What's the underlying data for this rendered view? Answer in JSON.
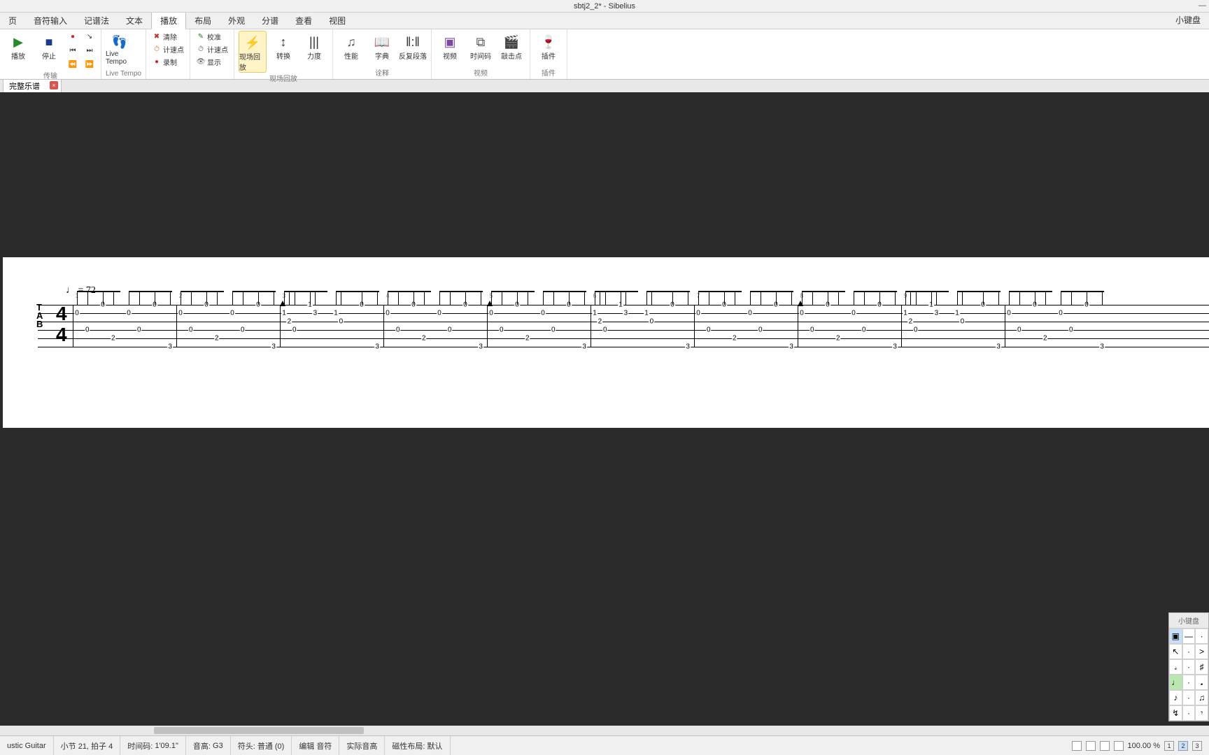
{
  "window": {
    "title": "sbtj2_2* - Sibelius",
    "minimize": "—"
  },
  "menu": {
    "tabs": [
      "页",
      "音符输入",
      "记谱法",
      "文本",
      "播放",
      "布局",
      "外观",
      "分谱",
      "查看",
      "视图"
    ],
    "active_index": 4,
    "right_label": "小键盘"
  },
  "ribbon": {
    "groups": [
      {
        "label": "传输",
        "items": [
          {
            "kind": "big",
            "name": "播放",
            "icon": "▶",
            "color": "#2a8a2a"
          },
          {
            "kind": "big",
            "name": "停止",
            "icon": "■",
            "color": "#1a3a8a"
          },
          {
            "kind": "transport",
            "cells": [
              "●",
              "↘",
              "⏮",
              "⏭",
              "⏪",
              "⏩"
            ]
          }
        ]
      },
      {
        "label": "Live Tempo",
        "items": [
          {
            "kind": "big",
            "name": "Live Tempo",
            "icon": "👣",
            "selected": false
          }
        ]
      },
      {
        "label": "",
        "items": [
          {
            "kind": "stack",
            "rows": [
              {
                "icon": "✖",
                "color": "#c03030",
                "label": "清除"
              },
              {
                "icon": "⏱",
                "color": "#c07030",
                "label": "计速点"
              },
              {
                "icon": "●",
                "color": "#c03030",
                "label": "录制"
              }
            ]
          }
        ]
      },
      {
        "label": "",
        "items": [
          {
            "kind": "stack",
            "rows": [
              {
                "icon": "✎",
                "color": "#2a7a2a",
                "label": "校准"
              },
              {
                "icon": "⏱",
                "color": "#555",
                "label": "计速点"
              },
              {
                "icon": "👁",
                "color": "#555",
                "label": "显示"
              }
            ]
          }
        ]
      },
      {
        "label": "现场回放",
        "items": [
          {
            "kind": "big",
            "name": "现场回放",
            "icon": "⚡",
            "color": "#e0a000",
            "selected": true
          },
          {
            "kind": "big",
            "name": "转换",
            "icon": "↕",
            "color": "#333"
          },
          {
            "kind": "big",
            "name": "力度",
            "icon": "|||",
            "color": "#333"
          }
        ]
      },
      {
        "label": "诠释",
        "items": [
          {
            "kind": "big",
            "name": "性能",
            "icon": "♫",
            "color": "#555"
          },
          {
            "kind": "big",
            "name": "字典",
            "icon": "📖",
            "color": "#7a4aa0"
          },
          {
            "kind": "big",
            "name": "反复段落",
            "icon": "‖:‖",
            "color": "#333"
          }
        ]
      },
      {
        "label": "视频",
        "items": [
          {
            "kind": "big",
            "name": "视频",
            "icon": "▣",
            "color": "#7a4aa0"
          },
          {
            "kind": "big",
            "name": "时间码",
            "icon": "⧉",
            "color": "#555"
          },
          {
            "kind": "big",
            "name": "敲击点",
            "icon": "🎬",
            "color": "#333"
          }
        ]
      },
      {
        "label": "插件",
        "items": [
          {
            "kind": "big",
            "name": "插件",
            "icon": "🍷",
            "color": "#8a5a2a"
          }
        ]
      }
    ]
  },
  "doctab": {
    "name": "完整乐谱",
    "close": "×"
  },
  "score": {
    "tempo_text": "♩ = 72",
    "tab_letters": [
      "T",
      "A",
      "B"
    ],
    "timesig_top": "4",
    "timesig_bot": "4",
    "measures": [
      1,
      2,
      3,
      4,
      5,
      6,
      7,
      8,
      9
    ]
  },
  "status": {
    "instrument": "ustic Guitar",
    "bar": "小节 21, 拍子 4",
    "timecode_label": "时间码:",
    "timecode": "1'09.1\"",
    "pitch_label": "音高:",
    "pitch": "G3",
    "notehead_label": "符头:",
    "notehead": "普通 (0)",
    "edit": "编辑 音符",
    "sounding": "实际音高",
    "layout_label": "磁性布局:",
    "layout": "默认",
    "zoom": "100.00 %",
    "pages": [
      "1",
      "2",
      "3"
    ]
  },
  "keypad": {
    "title": "小键盘",
    "rows": [
      [
        "▣",
        "—",
        "·"
      ],
      [
        "↖",
        "·",
        ">"
      ],
      [
        "𝅗",
        "·",
        "♯"
      ],
      [
        "♩",
        "·",
        "𝅘"
      ],
      [
        "♪",
        "·",
        "♫"
      ],
      [
        "↯",
        "·",
        "𝄾"
      ]
    ],
    "selected": [
      [
        0,
        0
      ],
      [
        3,
        0
      ]
    ]
  }
}
